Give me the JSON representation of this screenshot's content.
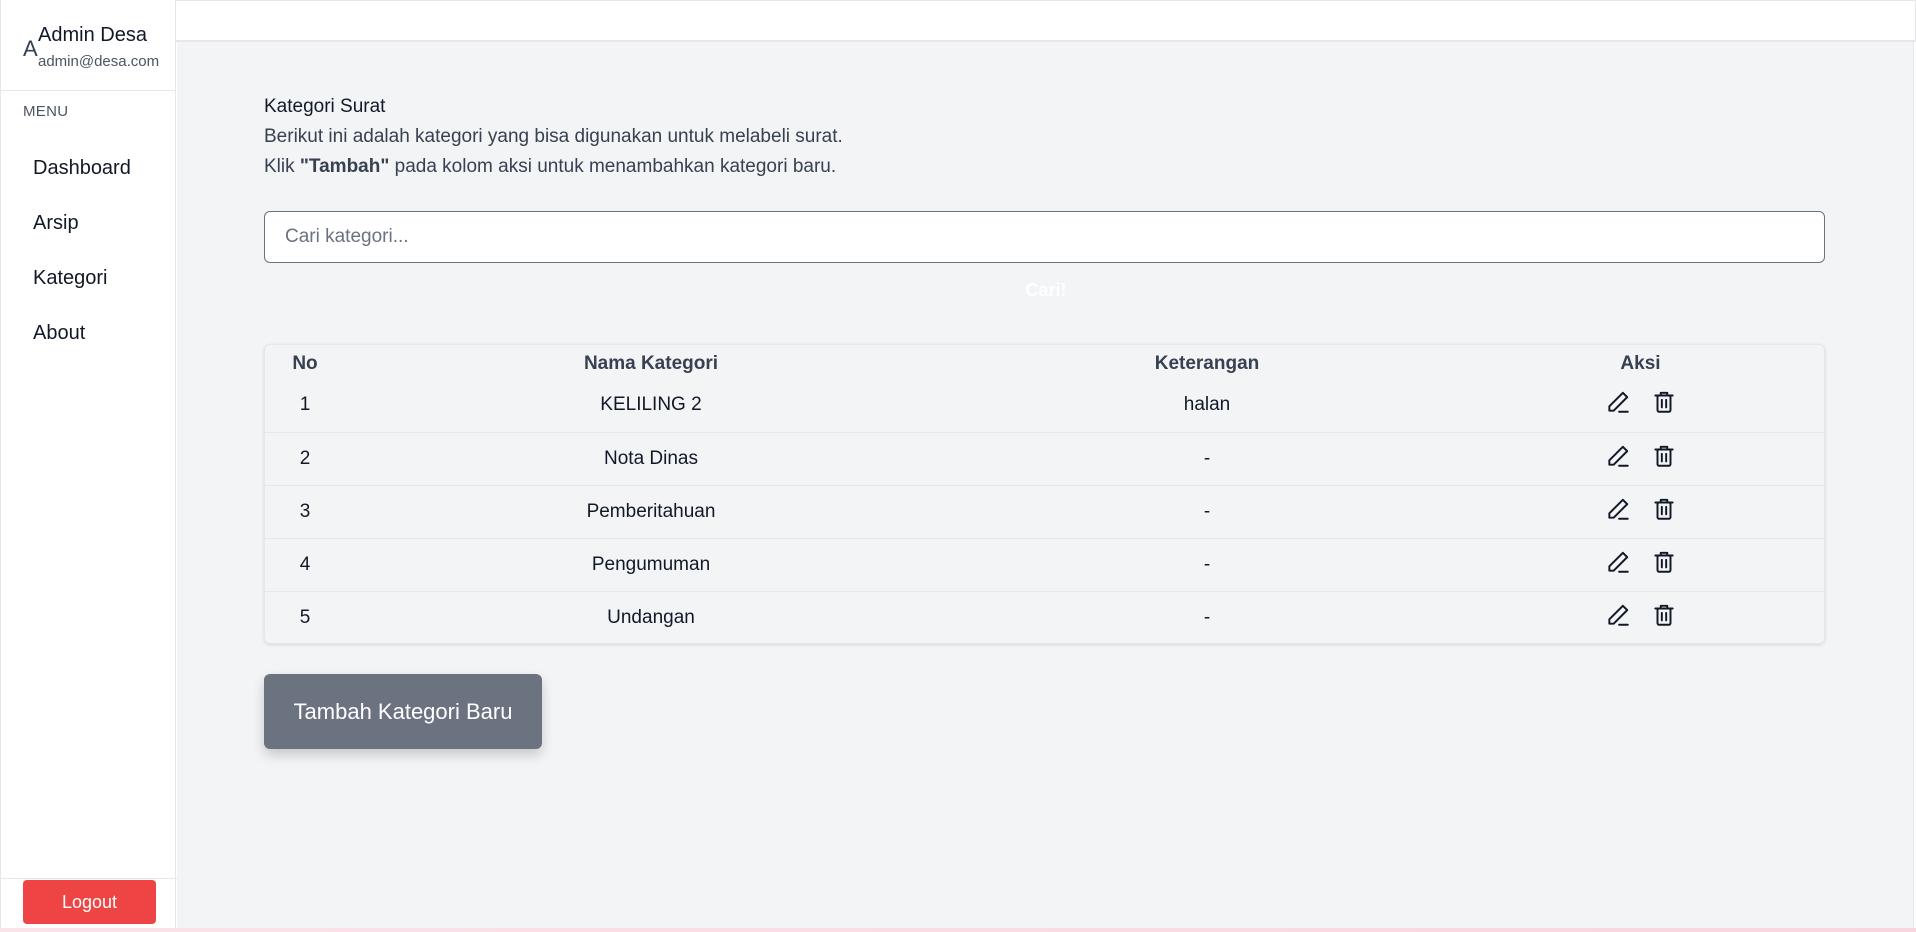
{
  "user": {
    "initial": "A",
    "name": "Admin Desa",
    "email": "admin@desa.com"
  },
  "sidebar": {
    "menu_heading": "MENU",
    "items": [
      {
        "label": "Dashboard"
      },
      {
        "label": "Arsip"
      },
      {
        "label": "Kategori"
      },
      {
        "label": "About"
      }
    ],
    "logout_label": "Logout"
  },
  "page": {
    "title": "Kategori Surat",
    "description_line1": "Berikut ini adalah kategori yang bisa digunakan untuk melabeli surat.",
    "description_line2_prefix": "Klik ",
    "description_line2_bold": "\"Tambah\"",
    "description_line2_suffix": " pada kolom aksi untuk menambahkan kategori baru."
  },
  "search": {
    "placeholder": "Cari kategori...",
    "button_label": "Cari!"
  },
  "table": {
    "headers": [
      "No",
      "Nama Kategori",
      "Keterangan",
      "Aksi"
    ],
    "rows": [
      {
        "no": "1",
        "name": "KELILING 2",
        "keterangan": "halan"
      },
      {
        "no": "2",
        "name": "Nota Dinas",
        "keterangan": "-"
      },
      {
        "no": "3",
        "name": "Pemberitahuan",
        "keterangan": "-"
      },
      {
        "no": "4",
        "name": "Pengumuman",
        "keterangan": "-"
      },
      {
        "no": "5",
        "name": "Undangan",
        "keterangan": "-"
      }
    ],
    "action_icons": [
      "edit-icon",
      "trash-icon"
    ]
  },
  "add_button_label": "Tambah Kategori Baru",
  "colors": {
    "logout": "#ef4444",
    "add_button": "#6b7280",
    "main_bg": "#f3f4f6"
  }
}
